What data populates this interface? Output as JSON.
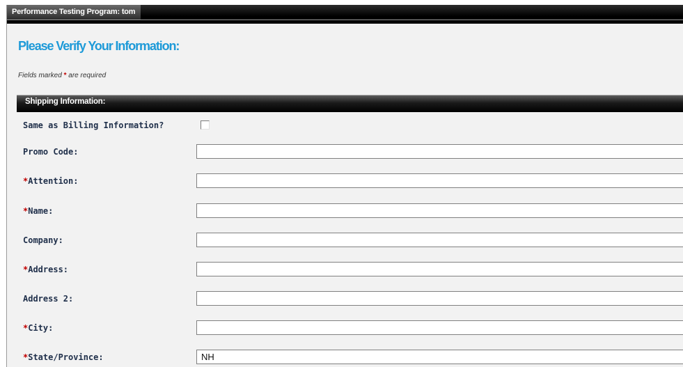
{
  "window": {
    "title": "Performance Testing Program: tom"
  },
  "page": {
    "title": "Please Verify Your Information:",
    "required_note_before": "Fields marked",
    "required_marker": "*",
    "required_note_after": "are required"
  },
  "section": {
    "title": "Shipping Information:",
    "same_as_billing_label": "Same as Billing Information?",
    "same_as_billing_checked": false,
    "fields": {
      "promo_code": {
        "label": "Promo Code:",
        "value": ""
      },
      "attention": {
        "label": "Attention:",
        "value": ""
      },
      "name": {
        "label": "Name:",
        "value": ""
      },
      "company": {
        "label": "Company:",
        "value": ""
      },
      "address": {
        "label": "Address:",
        "value": ""
      },
      "address2": {
        "label": "Address 2:",
        "value": ""
      },
      "city": {
        "label": "City:",
        "value": ""
      },
      "state": {
        "label": "State/Province:",
        "value": "NH"
      }
    }
  },
  "colors": {
    "title_blue": "#1e9ad8",
    "required_red": "#c00000",
    "bar_black": "#000000",
    "label_navy": "#1f2f4a"
  }
}
